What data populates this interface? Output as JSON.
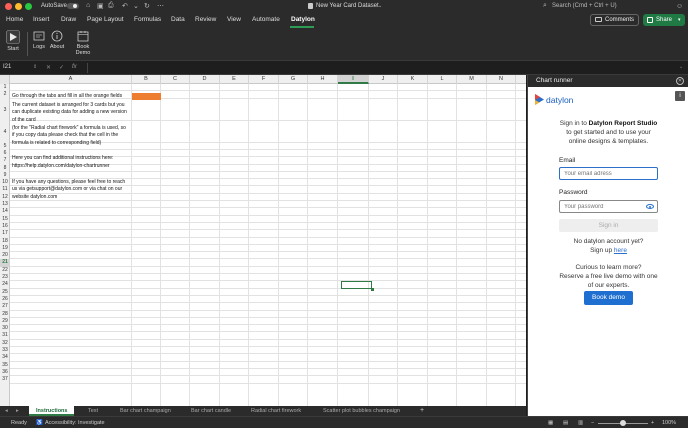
{
  "window": {
    "title": "New Year Card Dataset",
    "autosave_label": "AutoSave",
    "search_placeholder": "Search (Cmd + Ctrl + U)"
  },
  "ribbon_tabs": [
    "Home",
    "Insert",
    "Draw",
    "Page Layout",
    "Formulas",
    "Data",
    "Review",
    "View",
    "Automate",
    "Datylon"
  ],
  "active_tab": "Datylon",
  "header_buttons": {
    "comments": "Comments",
    "share": "Share"
  },
  "ribbon": {
    "start": "Start",
    "logs": "Logs",
    "about": "About",
    "book_demo_line1": "Book",
    "book_demo_line2": "Demo"
  },
  "formula_bar": {
    "name_box": "I21",
    "fx": "fx"
  },
  "columns": [
    "A",
    "B",
    "C",
    "D",
    "E",
    "F",
    "G",
    "H",
    "I",
    "J",
    "K",
    "L",
    "M",
    "N"
  ],
  "selected_column": "I",
  "selected_row": 21,
  "row_count": 37,
  "cells": {
    "r2": "Go through the tabs and fill in all the orange fields",
    "r3a": "The current dataset is arranged for 3 cards but you",
    "r3b": "can duplicate existing data for adding a new version",
    "r3c": "of the card",
    "r4a": "(for the \"Radial chart firework\" a formula is used, so",
    "r4b": "if you copy data please check that the cell in the",
    "r4c": "formula is related to corresponding field)",
    "r6": "Here you can find additional instructions here:",
    "r7": "https://help.datylon.com/datylon-chartrunner",
    "r9a": "If you have any questions, please feel free to reach",
    "r9b": "us via getsupport@datylon.com or via chat on our",
    "r9c": "website datylon.com"
  },
  "sheet_tabs": [
    "Instructions",
    "Text",
    "Bar chart champaign",
    "Bar chart candle",
    "Radial chart firework",
    "Scatter plot bubbles champaign"
  ],
  "active_sheet": "Instructions",
  "status": {
    "ready": "Ready",
    "accessibility": "Accessibility: Investigate",
    "zoom": "100%"
  },
  "panel": {
    "title": "Chart runner",
    "logo": "datylon",
    "intro_line1": "Sign in to",
    "intro_bold": "Datylon Report Studio",
    "intro_line2": "to get started and to use your",
    "intro_line3": "online designs & templates.",
    "email_label": "Email",
    "email_placeholder": "Your email adress",
    "password_label": "Password",
    "password_placeholder": "Your password",
    "signin": "Sign in",
    "no_account": "No datylon account yet?",
    "signup_prefix": "Sign up",
    "signup_link": "here",
    "curious_line1": "Curious to learn more?",
    "curious_line2": "Reserve a free live demo with one",
    "curious_line3": "of our experts.",
    "book_demo": "Book demo"
  },
  "colors": {
    "accent_green": "#2f7a45",
    "orange_field": "#ed7d31",
    "datylon_blue": "#1f6fd1"
  }
}
